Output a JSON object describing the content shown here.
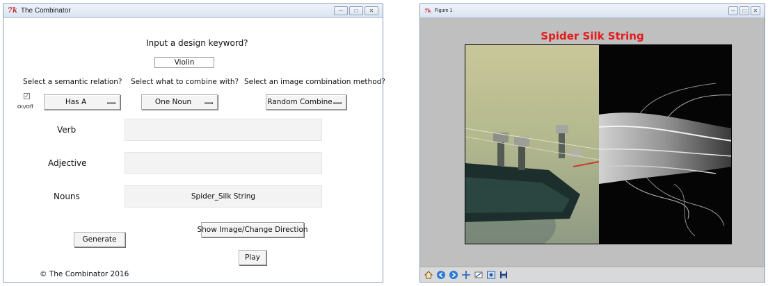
{
  "combinator": {
    "window_title": "The Combinator",
    "keyword_prompt": "Input a design keyword?",
    "keyword_value": "Violin",
    "semantic_prompt": "Select a semantic relation?",
    "combine_prompt": "Select what to combine with?",
    "method_prompt": "Select an image combination method?",
    "onoff_label": "On/Off",
    "semantic_value": "Has A",
    "combine_value": "One Noun",
    "method_value": "Random Combine",
    "verb_label": "Verb",
    "verb_value": "",
    "adjective_label": "Adjective",
    "adjective_value": "",
    "nouns_label": "Nouns",
    "nouns_value": "Spider_Silk String",
    "generate_label": "Generate",
    "show_image_label": "Show Image/Change Direction",
    "play_label": "Play",
    "copyright": "© The Combinator 2016"
  },
  "figure": {
    "window_title": "Figure 1",
    "plot_title": "Spider Silk String"
  },
  "icons": {
    "tk_logo": "7k",
    "toolbar": [
      "home-icon",
      "back-icon",
      "forward-icon",
      "pan-icon",
      "zoom-icon",
      "configure-icon",
      "save-icon"
    ]
  },
  "colors": {
    "title_red": "#e31b1b",
    "figure_bg": "#bfbfbf",
    "tk_logo": "#c4262e"
  }
}
